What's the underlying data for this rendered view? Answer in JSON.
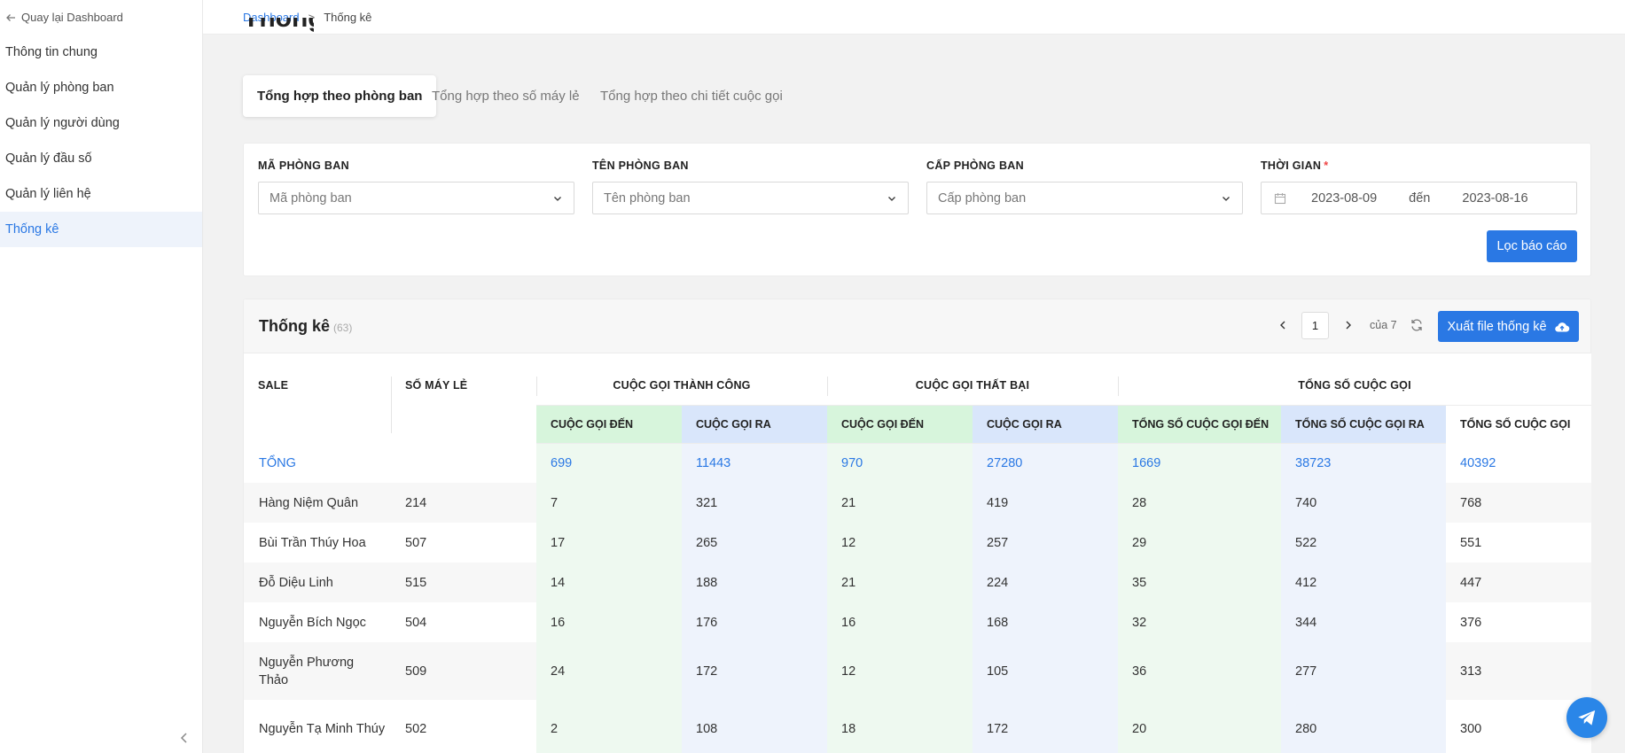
{
  "sidebar": {
    "back_label": "Quay lại Dashboard",
    "items": [
      {
        "label": "Thông tin chung"
      },
      {
        "label": "Quản lý phòng ban"
      },
      {
        "label": "Quản lý người dùng"
      },
      {
        "label": "Quản lý đầu số"
      },
      {
        "label": "Quản lý liên hệ"
      },
      {
        "label": "Thống kê",
        "active": true
      }
    ]
  },
  "breadcrumb": {
    "root": "Dashboard",
    "separator": ">",
    "current": "Thống kê"
  },
  "page_title_peek": "Thống kê",
  "tabs": [
    {
      "label": "Tổng hợp theo phòng ban",
      "active": true
    },
    {
      "label": "Tổng hợp theo số máy lẻ"
    },
    {
      "label": "Tổng hợp theo chi tiết cuộc gọi"
    }
  ],
  "filters": {
    "dept_code": {
      "label": "MÃ PHÒNG BAN",
      "placeholder": "Mã phòng ban"
    },
    "dept_name": {
      "label": "TÊN PHÒNG BAN",
      "placeholder": "Tên phòng ban"
    },
    "dept_level": {
      "label": "CẤP PHÒNG BAN",
      "placeholder": "Cấp phòng ban"
    },
    "time": {
      "label": "THỜI GIAN",
      "required": "*",
      "from": "2023-08-09",
      "to_word": "đến",
      "to": "2023-08-16"
    },
    "submit_label": "Lọc báo cáo"
  },
  "stats": {
    "title": "Thống kê",
    "count": "(63)",
    "page": "1",
    "of_label": "của 7",
    "export_label": "Xuất file thống kê",
    "headers": {
      "sale": "SALE",
      "ext": "SỐ MÁY LẺ",
      "success": "CUỘC GỌI THÀNH CÔNG",
      "failed": "CUỘC GỌI THẤT BẠI",
      "total": "TỔNG SỐ CUỘC GỌI",
      "sub": [
        "CUỘC GỌI ĐẾN",
        "CUỘC GỌI RA",
        "CUỘC GỌI ĐẾN",
        "CUỘC GỌI RA",
        "TỔNG SỐ CUỘC GỌI ĐẾN",
        "TỔNG SỐ CUỘC GỌI RA",
        "TỔNG SỐ CUỘC GỌI"
      ]
    },
    "total_row": {
      "label": "TỔNG",
      "values": [
        "699",
        "11443",
        "970",
        "27280",
        "1669",
        "38723",
        "40392"
      ]
    },
    "rows": [
      {
        "name": "Hàng Niệm Quân",
        "ext": "214",
        "values": [
          "7",
          "321",
          "21",
          "419",
          "28",
          "740",
          "768"
        ]
      },
      {
        "name": "Bùi Trần Thúy Hoa",
        "ext": "507",
        "values": [
          "17",
          "265",
          "12",
          "257",
          "29",
          "522",
          "551"
        ]
      },
      {
        "name": "Đỗ Diệu Linh",
        "ext": "515",
        "values": [
          "14",
          "188",
          "21",
          "224",
          "35",
          "412",
          "447"
        ]
      },
      {
        "name": "Nguyễn Bích Ngọc",
        "ext": "504",
        "values": [
          "16",
          "176",
          "16",
          "168",
          "32",
          "344",
          "376"
        ]
      },
      {
        "name": "Nguyễn Phương Thảo",
        "ext": "509",
        "values": [
          "24",
          "172",
          "12",
          "105",
          "36",
          "277",
          "313"
        ]
      },
      {
        "name": "Nguyễn Tạ Minh Thúy",
        "ext": "502",
        "values": [
          "2",
          "108",
          "18",
          "172",
          "20",
          "280",
          "300"
        ]
      }
    ]
  },
  "colors": {
    "accent": "#2a78e4",
    "green_header": "#d7f5dc",
    "blue_header": "#d9e6fb"
  }
}
